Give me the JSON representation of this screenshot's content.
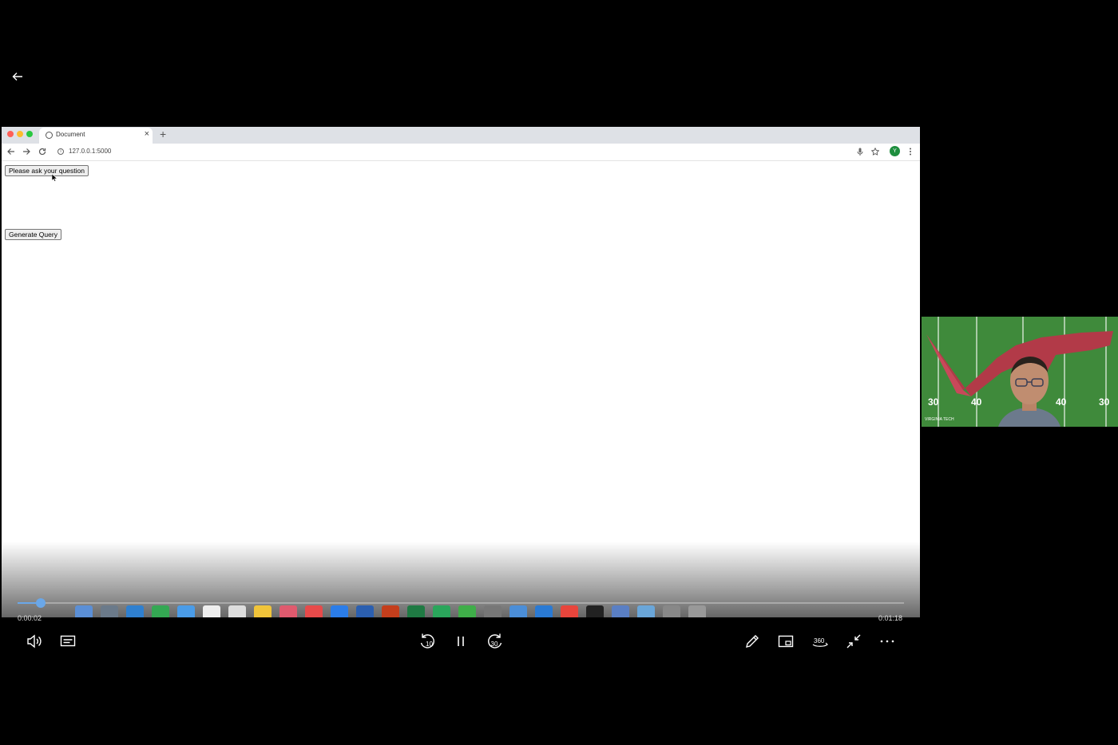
{
  "player": {
    "current_time": "0:00:02",
    "duration": "0:01:18",
    "progress": 0.026
  },
  "browser": {
    "tab_title": "Document",
    "url": "127.0.0.1:5000",
    "profile_initial": "Y"
  },
  "page": {
    "ask_button_label": "Please ask your question",
    "generate_button_label": "Generate Query"
  },
  "webcam": {
    "yard_numbers": [
      "30",
      "40",
      "40",
      "30"
    ],
    "logo_text": "VIRGINIA TECH"
  },
  "colors": {
    "seek_accent": "#6aa7e8",
    "traffic_red": "#fe5f57",
    "traffic_yellow": "#febc2e",
    "traffic_green": "#28c840"
  }
}
